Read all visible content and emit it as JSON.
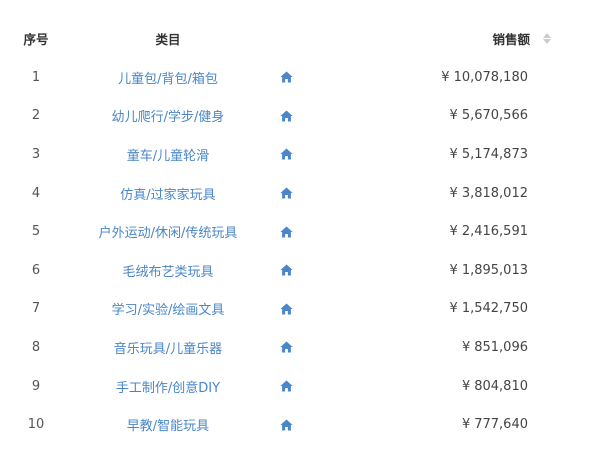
{
  "header": {
    "index_label": "序号",
    "category_label": "类目",
    "sales_label": "销售额"
  },
  "colors": {
    "link": "#4a86c8",
    "home_icon": "#4a86c8",
    "sort_arrows": "#c9ccd1"
  },
  "rows": [
    {
      "index": "1",
      "category": "儿童包/背包/箱包",
      "currency": "¥",
      "sales": "10,078,180"
    },
    {
      "index": "2",
      "category": "幼儿爬行/学步/健身",
      "currency": "¥",
      "sales": "5,670,566"
    },
    {
      "index": "3",
      "category": "童车/儿童轮滑",
      "currency": "¥",
      "sales": "5,174,873"
    },
    {
      "index": "4",
      "category": "仿真/过家家玩具",
      "currency": "¥",
      "sales": "3,818,012"
    },
    {
      "index": "5",
      "category": "户外运动/休闲/传统玩具",
      "currency": "¥",
      "sales": "2,416,591"
    },
    {
      "index": "6",
      "category": "毛绒布艺类玩具",
      "currency": "¥",
      "sales": "1,895,013"
    },
    {
      "index": "7",
      "category": "学习/实验/绘画文具",
      "currency": "¥",
      "sales": "1,542,750"
    },
    {
      "index": "8",
      "category": "音乐玩具/儿童乐器",
      "currency": "¥",
      "sales": "851,096"
    },
    {
      "index": "9",
      "category": "手工制作/创意DIY",
      "currency": "¥",
      "sales": "804,810"
    },
    {
      "index": "10",
      "category": "早教/智能玩具",
      "currency": "¥",
      "sales": "777,640"
    }
  ]
}
